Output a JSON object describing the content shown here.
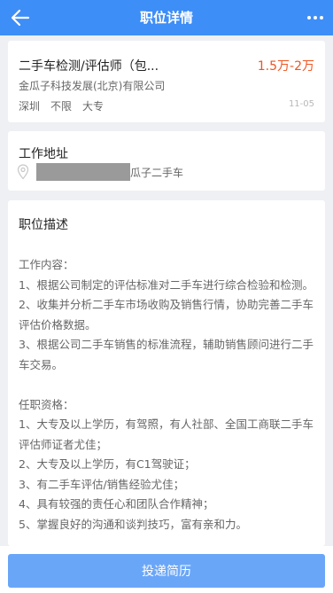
{
  "header": {
    "title": "职位详情",
    "back_icon": "arrow-left-icon",
    "more_icon": "more-dots-icon",
    "background": "#3e8ef7"
  },
  "job": {
    "title": "二手车检测/评估师（包...",
    "salary": "1.5万-2万",
    "company": "金瓜子科技发展(北京)有限公司",
    "tags": [
      "深圳",
      "不限",
      "大专"
    ],
    "date": "11-05",
    "salary_color": "#f0541e"
  },
  "address": {
    "title": "工作地址",
    "pin_icon": "location-pin-icon",
    "text": "瓜子二手车"
  },
  "description": {
    "title": "职位描述",
    "lines": [
      "工作内容：",
      "1、根据公司制定的评估标准对二手车进行综合检验和检测。",
      "2、收集并分析二手车市场收购及销售行情，协助完善二手车评估价格数据。",
      "3、根据公司二手车销售的标准流程，辅助销售顾问进行二手车交易。",
      "",
      "任职资格：",
      "1、大专及以上学历，有驾照，有人社部、全国工商联二手车评估师证者尤佳；",
      "2、大专及以上学历，有C1驾驶证；",
      "3、有二手车评估/销售经验尤佳；",
      "4、具有较强的责任心和团队合作精神；",
      "5、掌握良好的沟通和谈判技巧，富有亲和力。"
    ]
  },
  "footer": {
    "apply_label": "投递简历",
    "button_color": "#6aa6f8"
  }
}
